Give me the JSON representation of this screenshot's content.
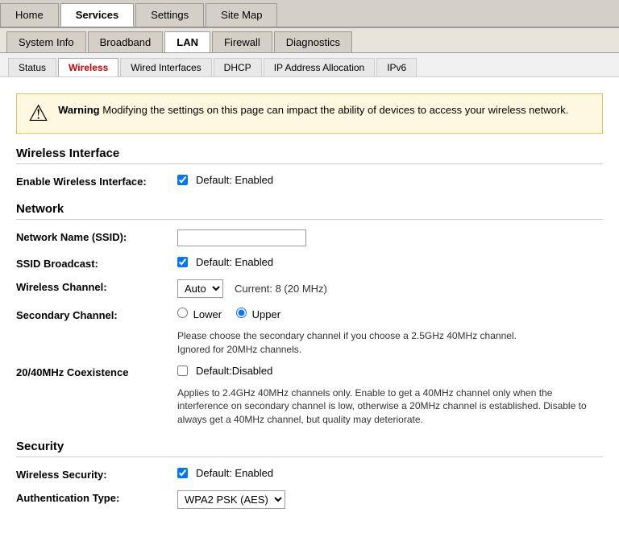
{
  "topNav": {
    "tabs": [
      "Home",
      "Services",
      "Settings",
      "Site Map"
    ],
    "activeTab": "Services"
  },
  "secondNav": {
    "tabs": [
      "System Info",
      "Broadband",
      "LAN",
      "Firewall",
      "Diagnostics"
    ],
    "activeTab": "LAN"
  },
  "thirdNav": {
    "tabs": [
      "Status",
      "Wireless",
      "Wired Interfaces",
      "DHCP",
      "IP Address Allocation",
      "IPv6"
    ],
    "activeTab": "Wireless"
  },
  "warning": {
    "icon": "⚠",
    "boldText": "Warning",
    "text": " Modifying the settings on this page can impact the ability of devices to access your wireless network."
  },
  "sections": {
    "wirelessInterface": {
      "title": "Wireless Interface",
      "fields": [
        {
          "label": "Enable Wireless Interface:",
          "type": "checkbox",
          "checked": true,
          "text": "Default: Enabled"
        }
      ]
    },
    "network": {
      "title": "Network",
      "fields": [
        {
          "label": "Network Name (SSID):",
          "type": "text",
          "value": ""
        },
        {
          "label": "SSID Broadcast:",
          "type": "checkbox",
          "checked": true,
          "text": "Default: Enabled"
        },
        {
          "label": "Wireless Channel:",
          "type": "select",
          "value": "Auto",
          "options": [
            "Auto"
          ],
          "currentInfo": "Current: 8 (20 MHz)"
        },
        {
          "label": "Secondary Channel:",
          "type": "radio",
          "options": [
            "Lower",
            "Upper"
          ],
          "selectedOption": "Upper",
          "note": "Please choose the secondary channel if you choose a 2.5GHz 40MHz channel.\nIgnored for 20MHz channels."
        },
        {
          "label": "20/40MHz Coexistence",
          "type": "checkbox",
          "checked": false,
          "text": "Default:Disabled",
          "note": "Applies to 2.4GHz 40MHz channels only. Enable to get a 40MHz channel only when the interference on secondary channel is low, otherwise a 20MHz channel is established. Disable to always get a 40MHz channel, but quality may deteriorate."
        }
      ]
    },
    "security": {
      "title": "Security",
      "fields": [
        {
          "label": "Wireless Security:",
          "type": "checkbox",
          "checked": true,
          "text": "Default: Enabled"
        },
        {
          "label": "Authentication Type:",
          "type": "select",
          "value": "WPA2 PSK (AES)",
          "options": [
            "WPA2 PSK (AES)"
          ]
        }
      ]
    }
  }
}
